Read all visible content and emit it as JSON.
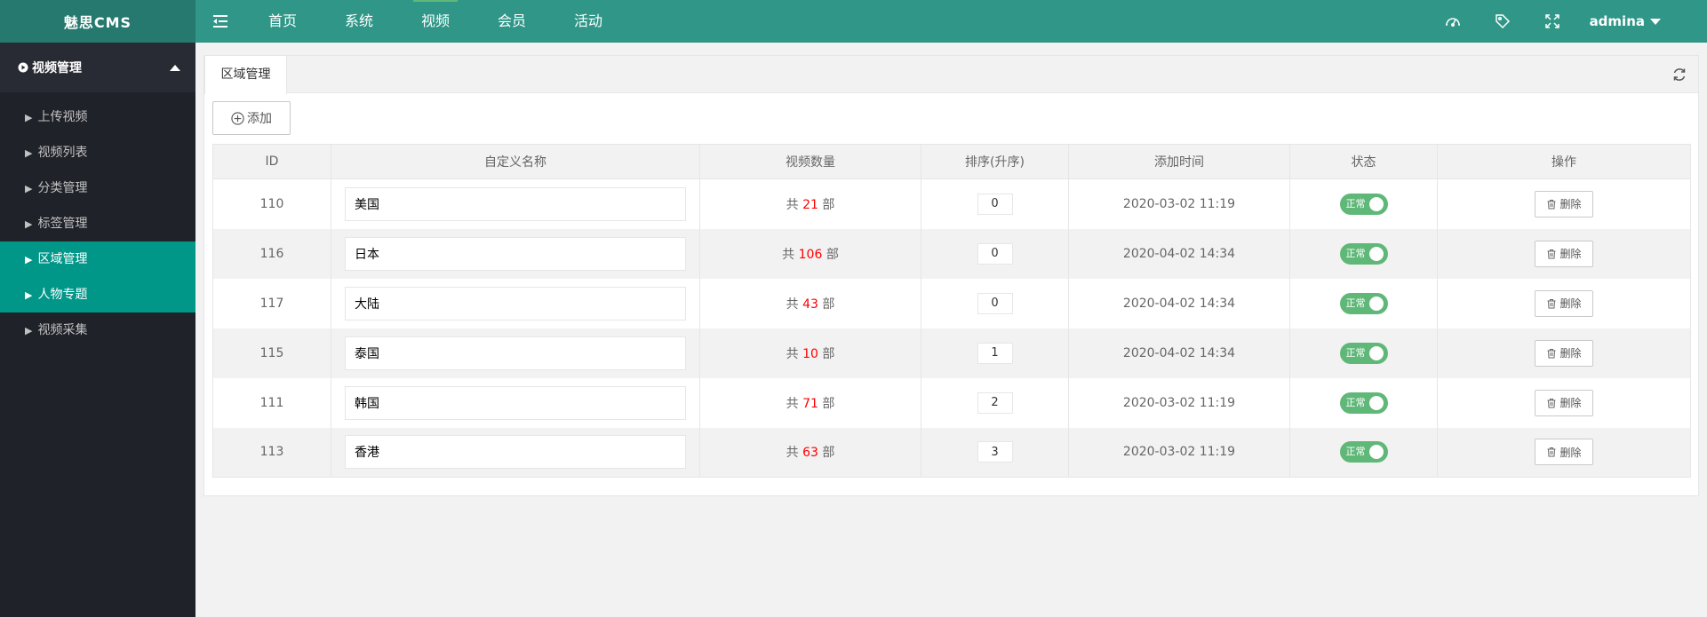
{
  "header": {
    "logo": "魅思CMS",
    "nav": [
      {
        "label": "首页",
        "active": false
      },
      {
        "label": "系统",
        "active": false
      },
      {
        "label": "视频",
        "active": true
      },
      {
        "label": "会员",
        "active": false
      },
      {
        "label": "活动",
        "active": false
      }
    ],
    "icons": [
      "theme-icon",
      "tag-icon",
      "fullscreen-icon"
    ],
    "user": "admina",
    "colors": {
      "bar": "#2f9688",
      "logo_bg": "#25796e",
      "active_line": "#5fb878"
    }
  },
  "sidebar": {
    "group_label": "视频管理",
    "items": [
      {
        "label": "上传视频"
      },
      {
        "label": "视频列表"
      },
      {
        "label": "分类管理"
      },
      {
        "label": "标签管理"
      },
      {
        "label": "区域管理"
      },
      {
        "label": "人物专题"
      },
      {
        "label": "视频采集"
      }
    ],
    "colors": {
      "bg": "#20222a",
      "highlight": "#009688"
    }
  },
  "tabs": {
    "current": "区域管理"
  },
  "toolbar": {
    "add_label": "添加"
  },
  "table": {
    "columns": [
      "ID",
      "自定义名称",
      "视频数量",
      "排序(升序)",
      "添加时间",
      "状态",
      "操作"
    ],
    "count_prefix": "共",
    "count_suffix": "部",
    "status_label": "正常",
    "delete_label": "删除",
    "rows": [
      {
        "id": "110",
        "name": "美国",
        "count": "21",
        "sort": "0",
        "time": "2020-03-02 11:19"
      },
      {
        "id": "116",
        "name": "日本",
        "count": "106",
        "sort": "0",
        "time": "2020-04-02 14:34"
      },
      {
        "id": "117",
        "name": "大陆",
        "count": "43",
        "sort": "0",
        "time": "2020-04-02 14:34"
      },
      {
        "id": "115",
        "name": "泰国",
        "count": "10",
        "sort": "1",
        "time": "2020-04-02 14:34"
      },
      {
        "id": "111",
        "name": "韩国",
        "count": "71",
        "sort": "2",
        "time": "2020-03-02 11:19"
      },
      {
        "id": "113",
        "name": "香港",
        "count": "63",
        "sort": "3",
        "time": "2020-03-02 11:19"
      }
    ],
    "colors": {
      "switch_on": "#5fb878",
      "count_highlight": "#ff0000"
    }
  }
}
